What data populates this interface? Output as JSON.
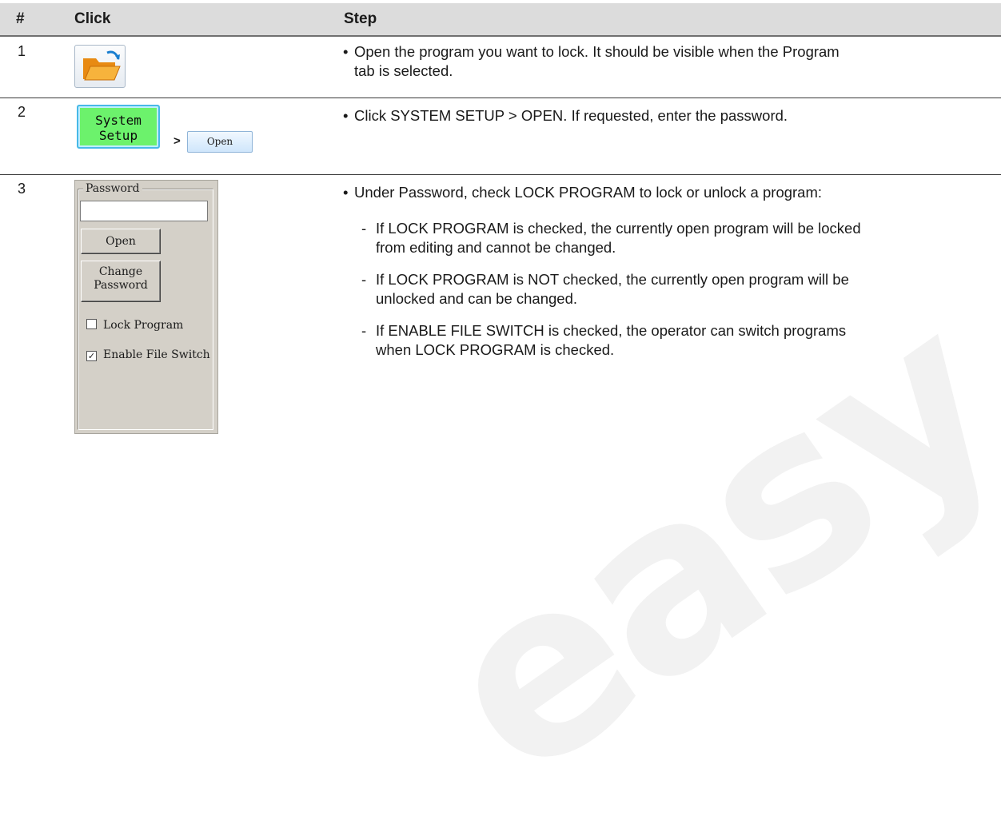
{
  "header": {
    "num": "#",
    "click": "Click",
    "step": "Step"
  },
  "rows": [
    {
      "num": "1",
      "icon": "open-folder-icon",
      "bullet": "Open the program you want to lock. It should be visible when the Program",
      "bullet2": "tab is selected."
    },
    {
      "num": "2",
      "system_setup_line1": "System",
      "system_setup_line2": "Setup",
      "arrow": ">",
      "open_label": "Open",
      "bullet": "Click SYSTEM SETUP > OPEN. If requested, enter the password."
    },
    {
      "num": "3",
      "panel": {
        "legend": "Password",
        "input_value": "",
        "open_label": "Open",
        "change_line1": "Change",
        "change_line2": "Password",
        "lock_label": "Lock Program",
        "lock_checked": false,
        "switch_label": "Enable File Switch",
        "switch_checked": true
      },
      "bullet": "Under Password, check LOCK PROGRAM to lock or unlock a program:",
      "subs": [
        {
          "l1": "If LOCK PROGRAM is checked, the currently open program will be locked",
          "l2": "from editing and cannot be changed."
        },
        {
          "l1": "If LOCK PROGRAM is NOT checked, the currently open program will be",
          "l2": "unlocked and can be changed."
        },
        {
          "l1": "If ENABLE FILE SWITCH is checked, the operator can switch programs",
          "l2": "when LOCK PROGRAM is checked."
        }
      ]
    }
  ],
  "watermark": "easy"
}
